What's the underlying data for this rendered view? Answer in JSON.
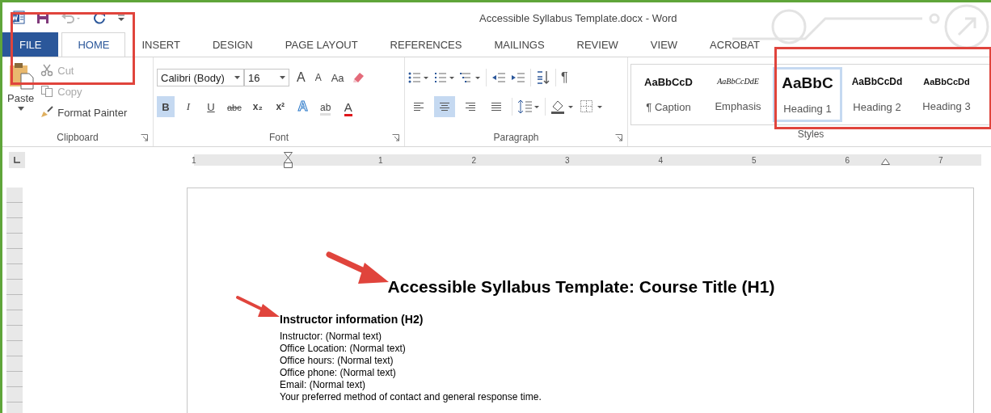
{
  "window": {
    "title": "Accessible Syllabus Template.docx - Word"
  },
  "tabs": [
    {
      "label": "FILE",
      "kind": "file",
      "selected": false
    },
    {
      "label": "HOME",
      "kind": "tab",
      "selected": true
    },
    {
      "label": "INSERT",
      "kind": "tab",
      "selected": false
    },
    {
      "label": "DESIGN",
      "kind": "tab",
      "selected": false
    },
    {
      "label": "PAGE LAYOUT",
      "kind": "tab",
      "selected": false
    },
    {
      "label": "REFERENCES",
      "kind": "tab",
      "selected": false
    },
    {
      "label": "MAILINGS",
      "kind": "tab",
      "selected": false
    },
    {
      "label": "REVIEW",
      "kind": "tab",
      "selected": false
    },
    {
      "label": "VIEW",
      "kind": "tab",
      "selected": false
    },
    {
      "label": "ACROBAT",
      "kind": "tab",
      "selected": false
    }
  ],
  "clipboard": {
    "label": "Clipboard",
    "paste": "Paste",
    "cut": {
      "label": "Cut",
      "disabled": true
    },
    "copy": {
      "label": "Copy",
      "disabled": true
    },
    "format_painter": {
      "label": "Format Painter",
      "disabled": false
    }
  },
  "font": {
    "label": "Font",
    "font_name": "Calibri (Body)",
    "font_size": "16",
    "size_tools": [
      {
        "label": "A",
        "kind": "grow"
      },
      {
        "label": "A",
        "kind": "shrink"
      },
      {
        "label": "Aa",
        "kind": "case"
      }
    ],
    "format_buttons": [
      {
        "label": "B",
        "kind": "bold",
        "selected": true
      },
      {
        "label": "I",
        "kind": "italic",
        "selected": false
      },
      {
        "label": "U",
        "kind": "underline",
        "selected": false
      },
      {
        "label": "abc",
        "kind": "strike",
        "selected": false
      },
      {
        "label": "x₂",
        "kind": "sub",
        "selected": false
      },
      {
        "label": "x²",
        "kind": "sup",
        "selected": false
      },
      {
        "label": "A",
        "kind": "effects",
        "selected": false
      },
      {
        "label": "ab",
        "kind": "highlight",
        "selected": false
      },
      {
        "label": "A",
        "kind": "color",
        "selected": false
      }
    ]
  },
  "paragraph": {
    "label": "Paragraph",
    "pilcrow": "¶",
    "alignment": [
      {
        "kind": "left",
        "selected": false
      },
      {
        "kind": "center",
        "selected": true
      },
      {
        "kind": "right",
        "selected": false
      },
      {
        "kind": "justify",
        "selected": false
      }
    ]
  },
  "styles": {
    "label": "Styles",
    "items": [
      {
        "preview": "AaBbCcD",
        "name": "¶ Caption",
        "kind": "caption",
        "selected": false
      },
      {
        "preview": "AaBbCcDdE",
        "name": "Emphasis",
        "kind": "emphasis",
        "selected": false
      },
      {
        "preview": "AaBbC",
        "name": "Heading 1",
        "kind": "h1",
        "selected": true
      },
      {
        "preview": "AaBbCcDd",
        "name": "Heading 2",
        "kind": "h2",
        "selected": false
      },
      {
        "preview": "AaBbCcDd",
        "name": "Heading 3",
        "kind": "h3",
        "selected": false
      }
    ]
  },
  "ruler": {
    "labels": [
      "1",
      "1",
      "2",
      "3",
      "4",
      "5",
      "6",
      "7"
    ]
  },
  "document": {
    "title": "Accessible Syllabus Template: Course Title (H1)",
    "heading": "Instructor information (H2)",
    "lines": [
      "Instructor: (Normal text)",
      "Office Location: (Normal text)",
      "Office hours: (Normal text)",
      "Office phone: (Normal text)",
      "Email: (Normal text)",
      "Your preferred method of contact and general response time."
    ]
  }
}
